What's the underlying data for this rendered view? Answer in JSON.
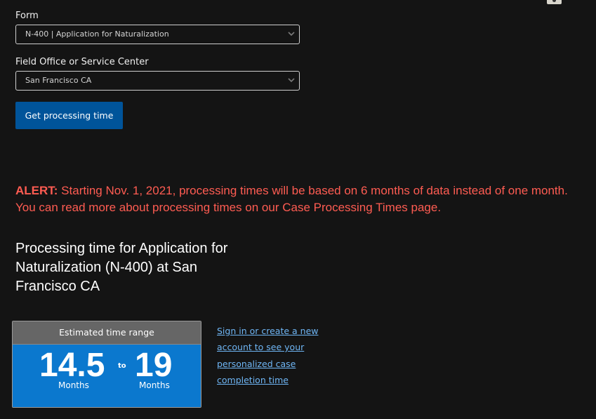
{
  "form": {
    "form_label": "Form",
    "form_value": "N-400 | Application for Naturalization",
    "office_label": "Field Office or Service Center",
    "office_value": "San Francisco CA",
    "submit_label": "Get processing time"
  },
  "alert": {
    "prefix": "ALERT:",
    "text": " Starting Nov. 1, 2021, processing times will be based on 6 months of data instead of one month. You can read more about processing times on our Case Processing Times page."
  },
  "result": {
    "heading": "Processing time for Application for Naturalization (N-400) at San Francisco CA",
    "card_title": "Estimated time range",
    "min_value": "14.5",
    "min_unit": "Months",
    "separator": "to",
    "max_value": "19",
    "max_unit": "Months"
  },
  "link": {
    "text": "Sign in or create a new account to see your personalized case completion time"
  },
  "colors": {
    "background": "#141414",
    "button": "#00549a",
    "alert": "#ff5c52",
    "card_header": "#666666",
    "card_body": "#0b78ce",
    "link": "#6fb6f5"
  }
}
